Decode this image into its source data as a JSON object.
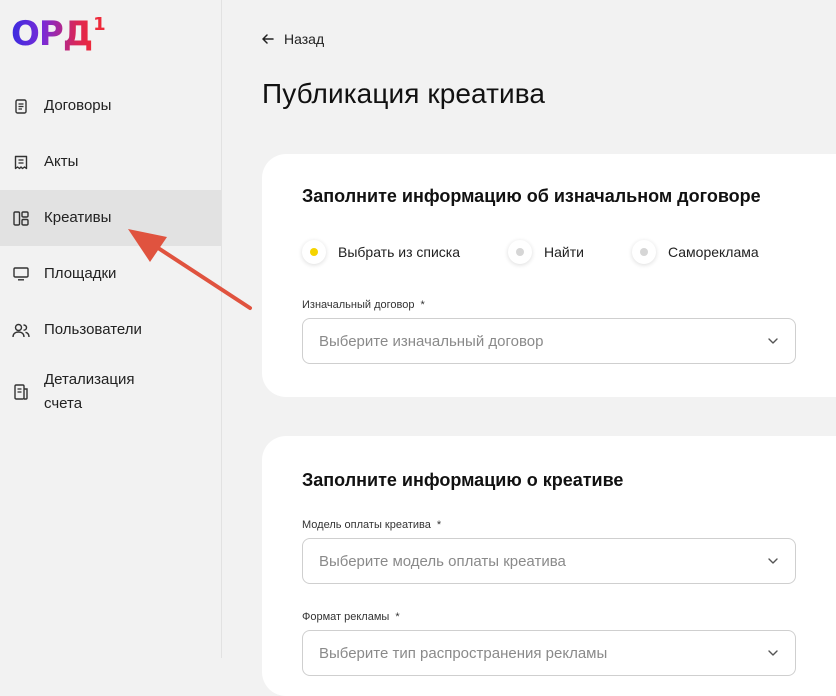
{
  "logo": {
    "text": "ОРД",
    "sup": "1"
  },
  "sidebar": {
    "items": [
      {
        "label": "Договоры",
        "icon": "document-icon",
        "active": false
      },
      {
        "label": "Акты",
        "icon": "receipt-icon",
        "active": false
      },
      {
        "label": "Креативы",
        "icon": "layout-icon",
        "active": true
      },
      {
        "label": "Площадки",
        "icon": "monitor-icon",
        "active": false
      },
      {
        "label": "Пользователи",
        "icon": "users-icon",
        "active": false
      },
      {
        "label": "Детализация счета",
        "icon": "invoice-icon",
        "active": false
      }
    ]
  },
  "header": {
    "back_label": "Назад",
    "title": "Публикация креатива"
  },
  "contract_card": {
    "title": "Заполните информацию об изначальном договоре",
    "radios": [
      {
        "label": "Выбрать из списка",
        "checked": true
      },
      {
        "label": "Найти",
        "checked": false
      },
      {
        "label": "Самореклама",
        "checked": false
      }
    ],
    "field_label": "Изначальный договор",
    "field_required": "*",
    "field_placeholder": "Выберите изначальный договор"
  },
  "creative_card": {
    "title": "Заполните информацию о креативе",
    "payment_label": "Модель оплаты креатива",
    "payment_required": "*",
    "payment_placeholder": "Выберите модель оплаты креатива",
    "format_label": "Формат рекламы",
    "format_required": "*",
    "format_placeholder": "Выберите тип распространения рекламы"
  },
  "colors": {
    "accent_yellow": "#f5d400",
    "annotation_arrow": "#e0533f",
    "logo_blue": "#3a2be0",
    "logo_red": "#ee2a3a"
  }
}
